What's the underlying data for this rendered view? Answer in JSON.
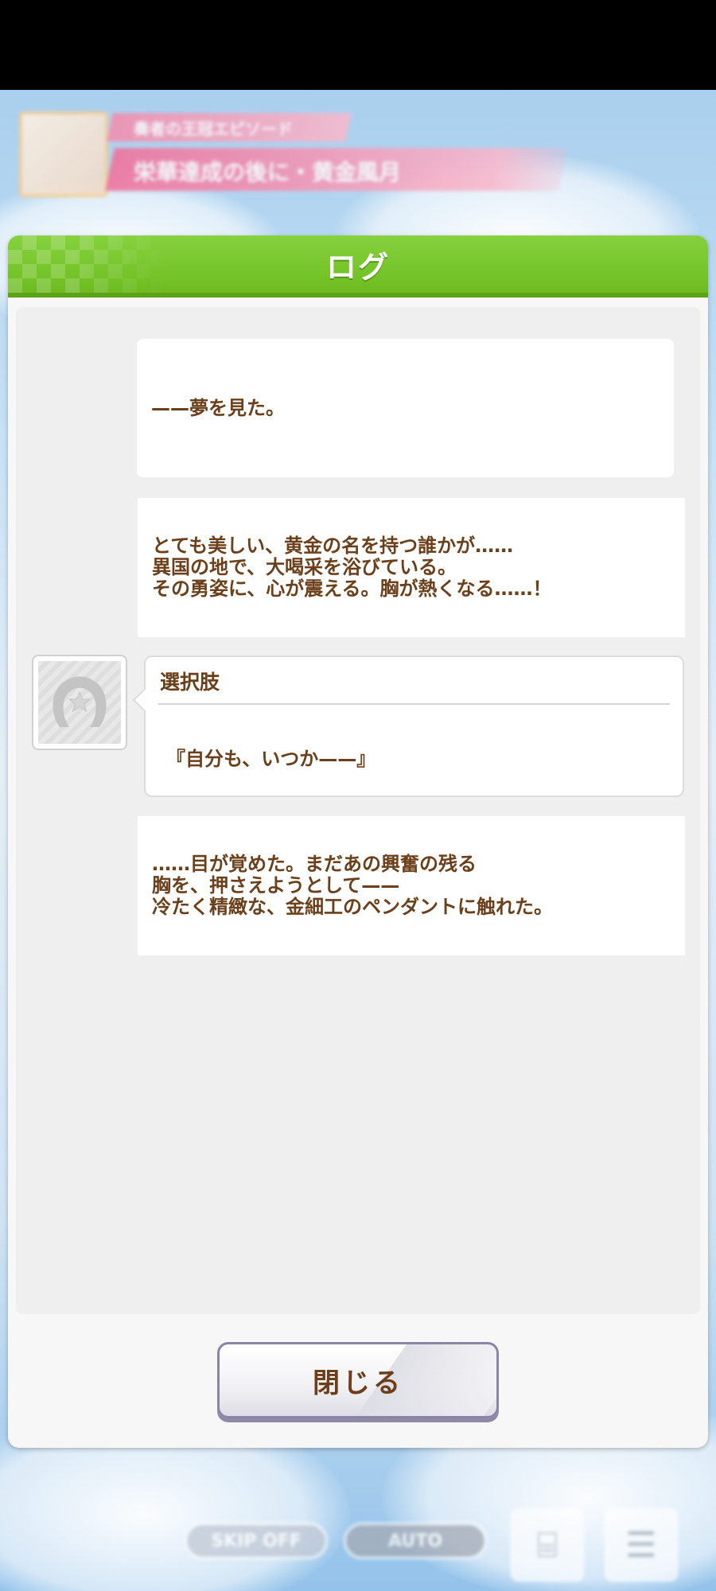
{
  "background": {
    "story_header": {
      "subtitle": "奏者の王冠エピソード",
      "title": "栄華達成の後に・黄金風月"
    },
    "controls": {
      "skip_label": "SKIP OFF",
      "auto_label": "AUTO",
      "log_label": "LOG"
    }
  },
  "dialog": {
    "title": "ログ",
    "entries": [
      {
        "text": "——夢を見た。"
      },
      {
        "text": "とても美しい、黄金の名を持つ誰かが……\n異国の地で、大喝采を浴びている。\nその勇姿に、心が震える。胸が熱くなる……！"
      },
      {
        "label": "選択肢",
        "text": "『自分も、いつか——』"
      },
      {
        "text": "……目が覚めた。まだあの興奮の残る\n胸を、押さえようとして——\n冷たく精緻な、金細工のペンダントに触れた。"
      }
    ],
    "close_label": "閉じる"
  },
  "colors": {
    "header_green": "#73c227",
    "text_brown": "#6b3f1a",
    "button_border": "#8b84a8"
  }
}
